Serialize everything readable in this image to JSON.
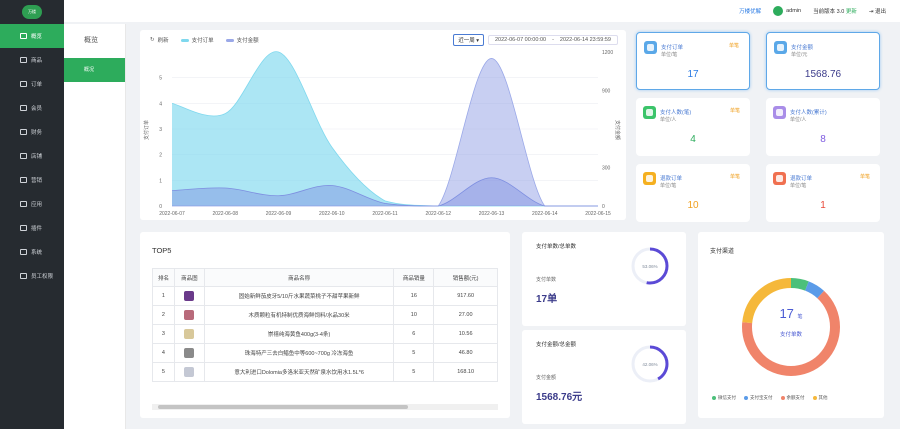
{
  "app": {
    "logo_text": "万楼"
  },
  "sidebar": {
    "items": [
      {
        "label": "概览",
        "name": "sidebar-item-overview",
        "active": true
      },
      {
        "label": "商品",
        "name": "sidebar-item-products"
      },
      {
        "label": "订单",
        "name": "sidebar-item-orders"
      },
      {
        "label": "会员",
        "name": "sidebar-item-members"
      },
      {
        "label": "财务",
        "name": "sidebar-item-finance"
      },
      {
        "label": "店铺",
        "name": "sidebar-item-store"
      },
      {
        "label": "营销",
        "name": "sidebar-item-marketing"
      },
      {
        "label": "应用",
        "name": "sidebar-item-apps"
      },
      {
        "label": "插件",
        "name": "sidebar-item-plugins"
      },
      {
        "label": "系统",
        "name": "sidebar-item-system"
      },
      {
        "label": "员工权限",
        "name": "sidebar-item-staff"
      }
    ]
  },
  "subside": {
    "title": "概览",
    "item": "概况"
  },
  "topbar": {
    "link": "万楼优解",
    "user": "admin",
    "version_label": "当前版本",
    "version": "3.0",
    "update": "更新",
    "logout": "退出"
  },
  "chart": {
    "legend_label": "刷新",
    "range_select": "近一周",
    "date_from": "2022-06-07 00:00:00",
    "date_sep": "-",
    "date_to": "2022-06-14 23:59:59"
  },
  "chart_data": {
    "type": "area",
    "x": [
      "2022-06-07",
      "2022-06-08",
      "2022-06-09",
      "2022-06-10",
      "2022-06-11",
      "2022-06-12",
      "2022-06-13",
      "2022-06-14",
      "2022-06-15"
    ],
    "series": [
      {
        "name": "支付订单",
        "color": "#7fd8ee",
        "axis": "left",
        "values": [
          4,
          3.6,
          6,
          2.3,
          0.2,
          0,
          0,
          0,
          0
        ]
      },
      {
        "name": "支付金额",
        "color": "#9aa8e8",
        "axis": "right",
        "values": [
          0,
          0,
          0,
          0,
          0,
          0,
          1150,
          0,
          0
        ]
      },
      {
        "name": "支付人数",
        "color": "#7d8ee0",
        "axis": "left",
        "values": [
          0.6,
          0.7,
          0.4,
          0.8,
          0.1,
          0,
          1.1,
          0,
          0
        ]
      }
    ],
    "ylim_left": [
      0,
      6
    ],
    "yticks_left": [
      0,
      1,
      2,
      3,
      4,
      5
    ],
    "ylim_right": [
      0,
      1200
    ],
    "yticks_right": [
      0,
      300,
      900,
      1200
    ],
    "ylabel_left": "支付订单",
    "ylabel_right": "支付金额"
  },
  "stats": [
    {
      "title": "支付订单",
      "sub": "单位/笔",
      "tag": "单笔",
      "tag_color": "#f0a020",
      "value": "17",
      "icon": "order-icon",
      "icon_color": "#5aa8e8",
      "value_color": "#2a7be4",
      "highlight": true
    },
    {
      "title": "支付金额",
      "sub": "单位/元",
      "tag": "",
      "tag_color": "",
      "value": "1568.76",
      "icon": "wallet-icon",
      "icon_color": "#5aa8e8",
      "value_color": "#3b3b8a",
      "highlight": true
    },
    {
      "title": "支付人数(笔)",
      "sub": "单位/人",
      "tag": "单笔",
      "tag_color": "#f0a020",
      "value": "4",
      "icon": "users-icon",
      "icon_color": "#3bc46a",
      "value_color": "#2dac5c",
      "highlight": false
    },
    {
      "title": "支付人数(累计)",
      "sub": "单位/人",
      "tag": "",
      "tag_color": "",
      "value": "8",
      "icon": "people-icon",
      "icon_color": "#a98de8",
      "value_color": "#7d5ae0",
      "highlight": false
    },
    {
      "title": "退款订单",
      "sub": "单位/笔",
      "tag": "单笔",
      "tag_color": "#f0a020",
      "value": "10",
      "icon": "refund-icon",
      "icon_color": "#f5b020",
      "value_color": "#f0a020",
      "highlight": false
    },
    {
      "title": "退款订单",
      "sub": "单位/笔",
      "tag": "单笔",
      "tag_color": "#f0a020",
      "value": "1",
      "icon": "refund-money-icon",
      "icon_color": "#f07050",
      "value_color": "#e84a3a",
      "highlight": false
    }
  ],
  "top5": {
    "title": "TOP5",
    "headers": [
      "排名",
      "商品图",
      "商品名称",
      "商品销量",
      "销售额(元)"
    ],
    "rows": [
      {
        "rank": "1",
        "name": "固始新鲜茄皮牙5/10斤水果蔬菜桃子不甜苹果新鲜",
        "qty": "16",
        "amount": "917.60",
        "thumb": "#6a3a8a"
      },
      {
        "rank": "2",
        "name": "木质颗粒有机特制优质海鲜饲料/水品30米",
        "qty": "10",
        "amount": "27.00",
        "thumb": "#b86a7a"
      },
      {
        "rank": "3",
        "name": "崇禧纯海黄鱼400g(3-4条)",
        "qty": "6",
        "amount": "10.56",
        "thumb": "#d8c89a"
      },
      {
        "rank": "4",
        "name": "珠海特产三去白鲳鱼中等600~700g 冷冻海鱼",
        "qty": "5",
        "amount": "46.80",
        "thumb": "#8a8a8a"
      },
      {
        "rank": "5",
        "name": "意大利进口Dolomia多洛米亚天然矿泉水饮用水1.5L*6",
        "qty": "5",
        "amount": "168.10",
        "thumb": "#c4c8d4"
      }
    ]
  },
  "ring1": {
    "title": "支付单数/总单数",
    "sub": "支付单数",
    "value": "17单",
    "percent": 53.06,
    "percent_label": "53.06%"
  },
  "ring2": {
    "title": "支付金额/总金额",
    "sub": "支付金额",
    "value": "1568.76元",
    "percent": 42.06,
    "percent_label": "42.06%"
  },
  "channel": {
    "title": "支付渠道",
    "count": "17",
    "unit": "笔",
    "label": "支付单数",
    "segments": [
      {
        "name": "微信支付",
        "value": 1,
        "color": "#4cc07a"
      },
      {
        "name": "支付宝支付",
        "value": 1,
        "color": "#5b9be8"
      },
      {
        "name": "余额支付",
        "value": 11,
        "color": "#f0846a"
      },
      {
        "name": "其他",
        "value": 4,
        "color": "#f5b83a"
      }
    ]
  }
}
